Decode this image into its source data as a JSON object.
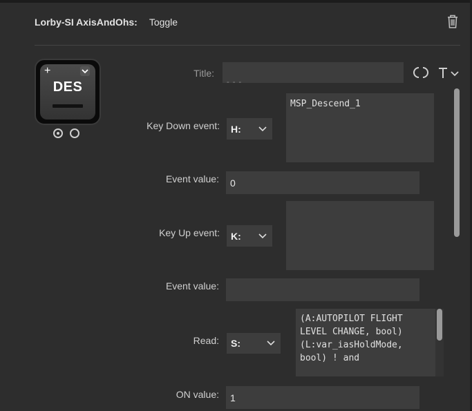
{
  "header": {
    "plugin_name": "Lorby-SI AxisAndOhs:",
    "action_name": "Toggle"
  },
  "key_preview": {
    "label": "DES",
    "plus": "+"
  },
  "form": {
    "title_label": "Title:",
    "title_value": "",
    "title_underline": "- - -",
    "key_down_label": "Key Down event:",
    "key_down_type": "H:",
    "key_down_code": "MSP_Descend_1",
    "event_value_label_1": "Event value:",
    "event_value_1": "0",
    "key_up_label": "Key Up event:",
    "key_up_type": "K:",
    "key_up_code": "",
    "event_value_label_2": "Event value:",
    "event_value_2": "",
    "read_label": "Read:",
    "read_type": "S:",
    "read_code": "(A:AUTOPILOT FLIGHT\nLEVEL CHANGE, bool)\n(L:var_iasHoldMode,\nbool) ! and",
    "on_value_label": "ON value:",
    "on_value": "1"
  }
}
